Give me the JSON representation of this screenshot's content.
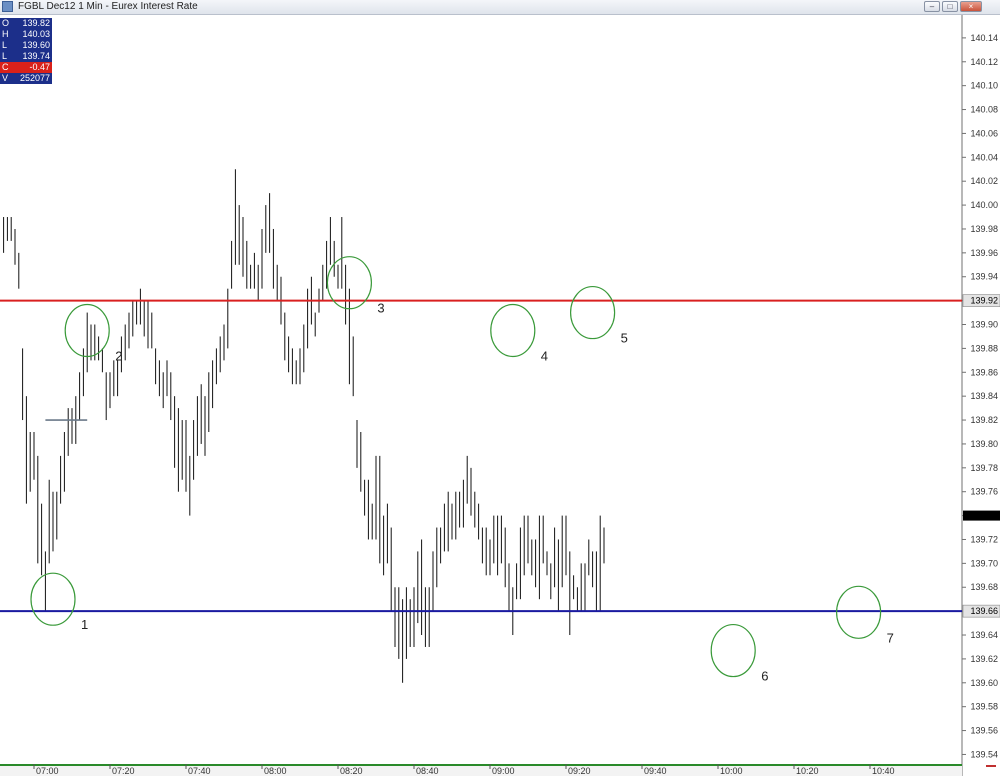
{
  "window": {
    "title": "FGBL Dec12 1 Min - Eurex Interest Rate",
    "minimize_icon": "minimize-icon",
    "maximize_icon": "maximize-icon",
    "close_icon": "close-icon"
  },
  "ohlc_box": [
    {
      "key": "O",
      "value": "139.82"
    },
    {
      "key": "H",
      "value": "140.03"
    },
    {
      "key": "L",
      "value": "139.60"
    },
    {
      "key": "L",
      "value": "139.74"
    },
    {
      "key": "C",
      "value": "-0.47"
    },
    {
      "key": "V",
      "value": "252077"
    }
  ],
  "colors": {
    "bars": "#111111",
    "resistance": "#d92020",
    "support": "#1a1aa0",
    "circles": "#3a9a3a",
    "axis_label_box": "#e4e4e4",
    "current_price_marker": "#000000",
    "ohlc_background": "#1c2f8a",
    "change_background": "#d9211a",
    "time_axis_line": "#2a8a2a"
  },
  "chart_data": {
    "type": "ohlc",
    "title": "FGBL Dec12 1 Min - Eurex Interest Rate",
    "ylim": [
      139.532,
      140.16
    ],
    "y_ticks": [
      "140.14",
      "140.12",
      "140.10",
      "140.08",
      "140.06",
      "140.04",
      "140.02",
      "140.00",
      "139.98",
      "139.96",
      "139.94",
      "139.92",
      "139.90",
      "139.88",
      "139.86",
      "139.84",
      "139.82",
      "139.80",
      "139.78",
      "139.76",
      "139.74",
      "139.72",
      "139.70",
      "139.68",
      "139.66",
      "139.64",
      "139.62",
      "139.60",
      "139.58",
      "139.56",
      "139.54"
    ],
    "x_ticks": [
      {
        "label": "07:00",
        "minute": 0
      },
      {
        "label": "07:20",
        "minute": 20
      },
      {
        "label": "07:40",
        "minute": 40
      },
      {
        "label": "08:00",
        "minute": 60
      },
      {
        "label": "08:20",
        "minute": 80
      },
      {
        "label": "08:40",
        "minute": 100
      },
      {
        "label": "09:00",
        "minute": 120
      },
      {
        "label": "09:20",
        "minute": 140
      },
      {
        "label": "09:40",
        "minute": 160
      },
      {
        "label": "10:00",
        "minute": 180
      },
      {
        "label": "10:20",
        "minute": 200
      },
      {
        "label": "10:40",
        "minute": 220
      }
    ],
    "horizontal_lines": [
      {
        "name": "resistance",
        "price": 139.92,
        "label": "139.92"
      },
      {
        "name": "support",
        "price": 139.66,
        "label": "139.66"
      }
    ],
    "current_price": 139.74,
    "gray_segment": {
      "price": 139.82,
      "from_minute": 3,
      "to_minute": 14
    },
    "annotations": [
      {
        "label": "1",
        "minute": 5,
        "price": 139.67
      },
      {
        "label": "2",
        "minute": 14,
        "price": 139.895
      },
      {
        "label": "3",
        "minute": 83,
        "price": 139.935
      },
      {
        "label": "4",
        "minute": 126,
        "price": 139.895
      },
      {
        "label": "5",
        "minute": 147,
        "price": 139.91
      },
      {
        "label": "6",
        "minute": 184,
        "price": 139.627
      },
      {
        "label": "7",
        "minute": 217,
        "price": 139.659
      }
    ],
    "bars": [
      {
        "m": -8,
        "h": 139.99,
        "l": 139.96
      },
      {
        "m": -7,
        "h": 139.99,
        "l": 139.97
      },
      {
        "m": -6,
        "h": 139.99,
        "l": 139.97
      },
      {
        "m": -5,
        "h": 139.98,
        "l": 139.95
      },
      {
        "m": -4,
        "h": 139.96,
        "l": 139.93
      },
      {
        "m": -3,
        "h": 139.88,
        "l": 139.82
      },
      {
        "m": -2,
        "h": 139.84,
        "l": 139.75
      },
      {
        "m": -1,
        "h": 139.81,
        "l": 139.76
      },
      {
        "m": 0,
        "h": 139.81,
        "l": 139.77
      },
      {
        "m": 1,
        "h": 139.79,
        "l": 139.7
      },
      {
        "m": 2,
        "h": 139.75,
        "l": 139.69
      },
      {
        "m": 3,
        "h": 139.71,
        "l": 139.66
      },
      {
        "m": 4,
        "h": 139.77,
        "l": 139.7
      },
      {
        "m": 5,
        "h": 139.76,
        "l": 139.71
      },
      {
        "m": 6,
        "h": 139.76,
        "l": 139.72
      },
      {
        "m": 7,
        "h": 139.79,
        "l": 139.75
      },
      {
        "m": 8,
        "h": 139.81,
        "l": 139.76
      },
      {
        "m": 9,
        "h": 139.83,
        "l": 139.79
      },
      {
        "m": 10,
        "h": 139.83,
        "l": 139.8
      },
      {
        "m": 11,
        "h": 139.84,
        "l": 139.8
      },
      {
        "m": 12,
        "h": 139.86,
        "l": 139.82
      },
      {
        "m": 13,
        "h": 139.88,
        "l": 139.84
      },
      {
        "m": 14,
        "h": 139.91,
        "l": 139.86
      },
      {
        "m": 15,
        "h": 139.9,
        "l": 139.87
      },
      {
        "m": 16,
        "h": 139.9,
        "l": 139.87
      },
      {
        "m": 17,
        "h": 139.89,
        "l": 139.87
      },
      {
        "m": 18,
        "h": 139.88,
        "l": 139.86
      },
      {
        "m": 19,
        "h": 139.86,
        "l": 139.82
      },
      {
        "m": 20,
        "h": 139.86,
        "l": 139.83
      },
      {
        "m": 21,
        "h": 139.87,
        "l": 139.84
      },
      {
        "m": 22,
        "h": 139.87,
        "l": 139.84
      },
      {
        "m": 23,
        "h": 139.89,
        "l": 139.86
      },
      {
        "m": 24,
        "h": 139.9,
        "l": 139.87
      },
      {
        "m": 25,
        "h": 139.91,
        "l": 139.88
      },
      {
        "m": 26,
        "h": 139.92,
        "l": 139.89
      },
      {
        "m": 27,
        "h": 139.92,
        "l": 139.9
      },
      {
        "m": 28,
        "h": 139.93,
        "l": 139.9
      },
      {
        "m": 29,
        "h": 139.92,
        "l": 139.89
      },
      {
        "m": 30,
        "h": 139.92,
        "l": 139.88
      },
      {
        "m": 31,
        "h": 139.91,
        "l": 139.88
      },
      {
        "m": 32,
        "h": 139.88,
        "l": 139.85
      },
      {
        "m": 33,
        "h": 139.87,
        "l": 139.84
      },
      {
        "m": 34,
        "h": 139.86,
        "l": 139.83
      },
      {
        "m": 35,
        "h": 139.87,
        "l": 139.84
      },
      {
        "m": 36,
        "h": 139.86,
        "l": 139.82
      },
      {
        "m": 37,
        "h": 139.84,
        "l": 139.78
      },
      {
        "m": 38,
        "h": 139.83,
        "l": 139.76
      },
      {
        "m": 39,
        "h": 139.82,
        "l": 139.77
      },
      {
        "m": 40,
        "h": 139.82,
        "l": 139.76
      },
      {
        "m": 41,
        "h": 139.79,
        "l": 139.74
      },
      {
        "m": 42,
        "h": 139.82,
        "l": 139.77
      },
      {
        "m": 43,
        "h": 139.84,
        "l": 139.79
      },
      {
        "m": 44,
        "h": 139.85,
        "l": 139.8
      },
      {
        "m": 45,
        "h": 139.84,
        "l": 139.79
      },
      {
        "m": 46,
        "h": 139.86,
        "l": 139.81
      },
      {
        "m": 47,
        "h": 139.87,
        "l": 139.83
      },
      {
        "m": 48,
        "h": 139.88,
        "l": 139.85
      },
      {
        "m": 49,
        "h": 139.89,
        "l": 139.86
      },
      {
        "m": 50,
        "h": 139.9,
        "l": 139.87
      },
      {
        "m": 51,
        "h": 139.93,
        "l": 139.88
      },
      {
        "m": 52,
        "h": 139.97,
        "l": 139.93
      },
      {
        "m": 53,
        "h": 140.03,
        "l": 139.95
      },
      {
        "m": 54,
        "h": 140.0,
        "l": 139.95
      },
      {
        "m": 55,
        "h": 139.99,
        "l": 139.94
      },
      {
        "m": 56,
        "h": 139.97,
        "l": 139.93
      },
      {
        "m": 57,
        "h": 139.95,
        "l": 139.93
      },
      {
        "m": 58,
        "h": 139.96,
        "l": 139.93
      },
      {
        "m": 59,
        "h": 139.95,
        "l": 139.92
      },
      {
        "m": 60,
        "h": 139.98,
        "l": 139.93
      },
      {
        "m": 61,
        "h": 140.0,
        "l": 139.96
      },
      {
        "m": 62,
        "h": 140.01,
        "l": 139.96
      },
      {
        "m": 63,
        "h": 139.98,
        "l": 139.93
      },
      {
        "m": 64,
        "h": 139.95,
        "l": 139.92
      },
      {
        "m": 65,
        "h": 139.94,
        "l": 139.9
      },
      {
        "m": 66,
        "h": 139.91,
        "l": 139.87
      },
      {
        "m": 67,
        "h": 139.89,
        "l": 139.86
      },
      {
        "m": 68,
        "h": 139.88,
        "l": 139.85
      },
      {
        "m": 69,
        "h": 139.87,
        "l": 139.85
      },
      {
        "m": 70,
        "h": 139.88,
        "l": 139.85
      },
      {
        "m": 71,
        "h": 139.9,
        "l": 139.86
      },
      {
        "m": 72,
        "h": 139.93,
        "l": 139.88
      },
      {
        "m": 73,
        "h": 139.94,
        "l": 139.9
      },
      {
        "m": 74,
        "h": 139.91,
        "l": 139.89
      },
      {
        "m": 75,
        "h": 139.93,
        "l": 139.91
      },
      {
        "m": 76,
        "h": 139.95,
        "l": 139.92
      },
      {
        "m": 77,
        "h": 139.97,
        "l": 139.93
      },
      {
        "m": 78,
        "h": 139.99,
        "l": 139.95
      },
      {
        "m": 79,
        "h": 139.97,
        "l": 139.94
      },
      {
        "m": 80,
        "h": 139.95,
        "l": 139.93
      },
      {
        "m": 81,
        "h": 139.99,
        "l": 139.93
      },
      {
        "m": 82,
        "h": 139.95,
        "l": 139.9
      },
      {
        "m": 83,
        "h": 139.93,
        "l": 139.85
      },
      {
        "m": 84,
        "h": 139.89,
        "l": 139.84
      },
      {
        "m": 85,
        "h": 139.82,
        "l": 139.78
      },
      {
        "m": 86,
        "h": 139.81,
        "l": 139.76
      },
      {
        "m": 87,
        "h": 139.77,
        "l": 139.74
      },
      {
        "m": 88,
        "h": 139.77,
        "l": 139.72
      },
      {
        "m": 89,
        "h": 139.75,
        "l": 139.72
      },
      {
        "m": 90,
        "h": 139.79,
        "l": 139.72
      },
      {
        "m": 91,
        "h": 139.79,
        "l": 139.7
      },
      {
        "m": 92,
        "h": 139.74,
        "l": 139.69
      },
      {
        "m": 93,
        "h": 139.75,
        "l": 139.7
      },
      {
        "m": 94,
        "h": 139.73,
        "l": 139.66
      },
      {
        "m": 95,
        "h": 139.68,
        "l": 139.63
      },
      {
        "m": 96,
        "h": 139.68,
        "l": 139.62
      },
      {
        "m": 97,
        "h": 139.67,
        "l": 139.6
      },
      {
        "m": 98,
        "h": 139.68,
        "l": 139.62
      },
      {
        "m": 99,
        "h": 139.67,
        "l": 139.63
      },
      {
        "m": 100,
        "h": 139.68,
        "l": 139.63
      },
      {
        "m": 101,
        "h": 139.71,
        "l": 139.65
      },
      {
        "m": 102,
        "h": 139.72,
        "l": 139.64
      },
      {
        "m": 103,
        "h": 139.68,
        "l": 139.63
      },
      {
        "m": 104,
        "h": 139.68,
        "l": 139.63
      },
      {
        "m": 105,
        "h": 139.71,
        "l": 139.66
      },
      {
        "m": 106,
        "h": 139.73,
        "l": 139.68
      },
      {
        "m": 107,
        "h": 139.73,
        "l": 139.7
      },
      {
        "m": 108,
        "h": 139.75,
        "l": 139.71
      },
      {
        "m": 109,
        "h": 139.76,
        "l": 139.71
      },
      {
        "m": 110,
        "h": 139.75,
        "l": 139.72
      },
      {
        "m": 111,
        "h": 139.76,
        "l": 139.72
      },
      {
        "m": 112,
        "h": 139.76,
        "l": 139.73
      },
      {
        "m": 113,
        "h": 139.77,
        "l": 139.73
      },
      {
        "m": 114,
        "h": 139.79,
        "l": 139.75
      },
      {
        "m": 115,
        "h": 139.78,
        "l": 139.74
      },
      {
        "m": 116,
        "h": 139.76,
        "l": 139.73
      },
      {
        "m": 117,
        "h": 139.75,
        "l": 139.72
      },
      {
        "m": 118,
        "h": 139.73,
        "l": 139.7
      },
      {
        "m": 119,
        "h": 139.73,
        "l": 139.69
      },
      {
        "m": 120,
        "h": 139.72,
        "l": 139.69
      },
      {
        "m": 121,
        "h": 139.74,
        "l": 139.7
      },
      {
        "m": 122,
        "h": 139.74,
        "l": 139.69
      },
      {
        "m": 123,
        "h": 139.74,
        "l": 139.7
      },
      {
        "m": 124,
        "h": 139.73,
        "l": 139.68
      },
      {
        "m": 125,
        "h": 139.7,
        "l": 139.66
      },
      {
        "m": 126,
        "h": 139.68,
        "l": 139.64
      },
      {
        "m": 127,
        "h": 139.7,
        "l": 139.67
      },
      {
        "m": 128,
        "h": 139.73,
        "l": 139.67
      },
      {
        "m": 129,
        "h": 139.74,
        "l": 139.69
      },
      {
        "m": 130,
        "h": 139.74,
        "l": 139.7
      },
      {
        "m": 131,
        "h": 139.72,
        "l": 139.69
      },
      {
        "m": 132,
        "h": 139.72,
        "l": 139.68
      },
      {
        "m": 133,
        "h": 139.74,
        "l": 139.67
      },
      {
        "m": 134,
        "h": 139.74,
        "l": 139.7
      },
      {
        "m": 135,
        "h": 139.71,
        "l": 139.69
      },
      {
        "m": 136,
        "h": 139.7,
        "l": 139.67
      },
      {
        "m": 137,
        "h": 139.73,
        "l": 139.68
      },
      {
        "m": 138,
        "h": 139.72,
        "l": 139.66
      },
      {
        "m": 139,
        "h": 139.74,
        "l": 139.68
      },
      {
        "m": 140,
        "h": 139.74,
        "l": 139.69
      },
      {
        "m": 141,
        "h": 139.71,
        "l": 139.64
      },
      {
        "m": 142,
        "h": 139.69,
        "l": 139.67
      },
      {
        "m": 143,
        "h": 139.68,
        "l": 139.66
      },
      {
        "m": 144,
        "h": 139.7,
        "l": 139.66
      },
      {
        "m": 145,
        "h": 139.7,
        "l": 139.66
      },
      {
        "m": 146,
        "h": 139.72,
        "l": 139.69
      },
      {
        "m": 147,
        "h": 139.71,
        "l": 139.68
      },
      {
        "m": 148,
        "h": 139.71,
        "l": 139.66
      },
      {
        "m": 149,
        "h": 139.74,
        "l": 139.66
      },
      {
        "m": 150,
        "h": 139.73,
        "l": 139.7
      }
    ]
  }
}
